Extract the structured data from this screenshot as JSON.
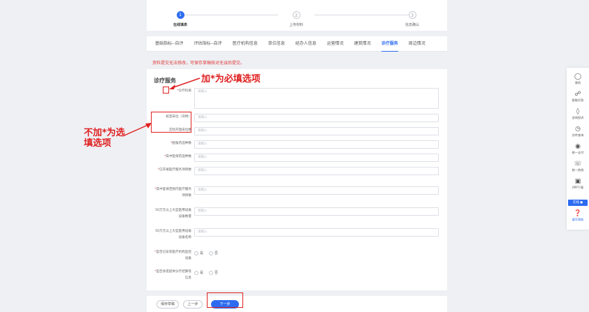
{
  "steps": [
    {
      "num": "1",
      "label": "在线填表"
    },
    {
      "num": "2",
      "label": "上传材料"
    },
    {
      "num": "3",
      "label": "信息确认"
    }
  ],
  "tabs": [
    "基础指标--自评",
    "评估指标--自评",
    "医疗机构信息",
    "单位信息",
    "经办人信息",
    "运营情况",
    "建筑情况",
    "诊疗服务",
    "周边情况"
  ],
  "notice": "资料提交无法修改，可保存草稿核对无误后提交。",
  "section_title": "诊疗服务",
  "placeholder": "请输入",
  "fields": {
    "f1": {
      "star": "*",
      "label": "诊疗科目"
    },
    "f2": {
      "label": "核定床位（牙椅）"
    },
    "f3": {
      "label": "实际开放床位数"
    },
    "f4": {
      "star": "*",
      "label": "配备药品种数"
    },
    "f5": {
      "star": "*",
      "label": "其中医保药品种数"
    },
    "f6": {
      "star": "*",
      "label": "已开展医疗服务项目数"
    },
    "f7": {
      "star": "*",
      "label": "其中医保范围内医疗服务项目数"
    },
    "f8": {
      "label": "50万元以上大型医用设备设备数量"
    },
    "f9": {
      "label": "50万元以上大型医用设备设备名称"
    },
    "f10": {
      "star": "*",
      "label": "是否已安装医疗机构监控设备"
    },
    "f11": {
      "star": "*",
      "label": "是否承诺提供诊疗结算等信息"
    }
  },
  "radio": {
    "yes": "是",
    "no": "否"
  },
  "buttons": {
    "save": "保存草稿",
    "prev": "上一步",
    "next": "下一步"
  },
  "annotations": {
    "required": "加*为必填选项",
    "optional_line1": "不加*为选",
    "optional_line2": "填选项"
  },
  "sidebar": {
    "mine": "我的",
    "smart_qa": "智能问答",
    "complaint": "咨询投诉",
    "progress": "办件查询",
    "one_pay": "统一支付",
    "hotline": "统一热线",
    "app": "APP下载",
    "online": "在线",
    "help": "填写帮助"
  }
}
